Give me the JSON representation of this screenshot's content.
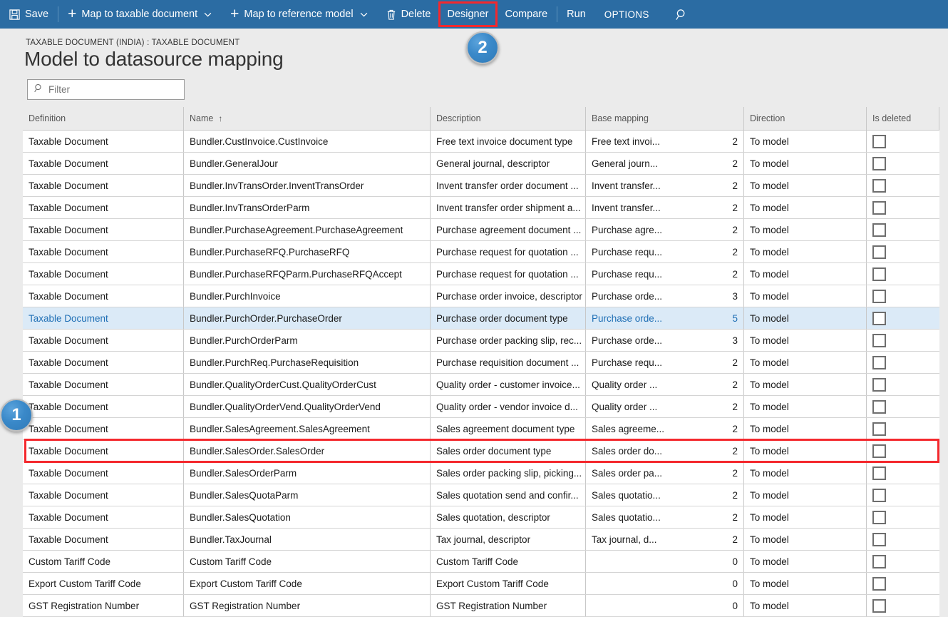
{
  "toolbar": {
    "save_label": "Save",
    "map_taxable_label": "Map to taxable document",
    "map_reference_label": "Map to reference model",
    "delete_label": "Delete",
    "designer_label": "Designer",
    "compare_label": "Compare",
    "run_label": "Run",
    "options_label": "OPTIONS",
    "chevron": "⌄",
    "plus": "+",
    "accent_color": "#2b6ca3",
    "highlight_color": "#f4282d"
  },
  "header": {
    "breadcrumb": "TAXABLE DOCUMENT (INDIA) : TAXABLE DOCUMENT",
    "title": "Model to datasource mapping"
  },
  "filter": {
    "placeholder": "Filter",
    "value": "Filter",
    "icon": "search-icon"
  },
  "grid": {
    "columns": [
      {
        "key": "definition",
        "label": "Definition"
      },
      {
        "key": "name",
        "label": "Name",
        "sorted": true,
        "sort_arrow": "↑"
      },
      {
        "key": "description",
        "label": "Description"
      },
      {
        "key": "base_mapping",
        "label": "Base mapping"
      },
      {
        "key": "direction",
        "label": "Direction"
      },
      {
        "key": "is_deleted",
        "label": "Is deleted"
      }
    ],
    "rows": [
      {
        "definition": "Taxable Document",
        "name": "Bundler.CustInvoice.CustInvoice",
        "description": "Free text invoice document type",
        "base_mapping": "Free text invoi...",
        "base_count": "2",
        "direction": "To model",
        "is_deleted": false,
        "selected": false
      },
      {
        "definition": "Taxable Document",
        "name": "Bundler.GeneralJour",
        "description": "General journal, descriptor",
        "base_mapping": "General journ...",
        "base_count": "2",
        "direction": "To model",
        "is_deleted": false,
        "selected": false
      },
      {
        "definition": "Taxable Document",
        "name": "Bundler.InvTransOrder.InventTransOrder",
        "description": "Invent transfer order document ...",
        "base_mapping": "Invent transfer...",
        "base_count": "2",
        "direction": "To model",
        "is_deleted": false,
        "selected": false
      },
      {
        "definition": "Taxable Document",
        "name": "Bundler.InvTransOrderParm",
        "description": "Invent transfer order shipment a...",
        "base_mapping": "Invent transfer...",
        "base_count": "2",
        "direction": "To model",
        "is_deleted": false,
        "selected": false
      },
      {
        "definition": "Taxable Document",
        "name": "Bundler.PurchaseAgreement.PurchaseAgreement",
        "description": "Purchase agreement document ...",
        "base_mapping": "Purchase agre...",
        "base_count": "2",
        "direction": "To model",
        "is_deleted": false,
        "selected": false
      },
      {
        "definition": "Taxable Document",
        "name": "Bundler.PurchaseRFQ.PurchaseRFQ",
        "description": "Purchase request for quotation ...",
        "base_mapping": "Purchase requ...",
        "base_count": "2",
        "direction": "To model",
        "is_deleted": false,
        "selected": false
      },
      {
        "definition": "Taxable Document",
        "name": "Bundler.PurchaseRFQParm.PurchaseRFQAccept",
        "description": "Purchase request for quotation ...",
        "base_mapping": "Purchase requ...",
        "base_count": "2",
        "direction": "To model",
        "is_deleted": false,
        "selected": false
      },
      {
        "definition": "Taxable Document",
        "name": "Bundler.PurchInvoice",
        "description": "Purchase order invoice, descriptor",
        "base_mapping": "Purchase orde...",
        "base_count": "3",
        "direction": "To model",
        "is_deleted": false,
        "selected": false
      },
      {
        "definition": "Taxable Document",
        "name": "Bundler.PurchOrder.PurchaseOrder",
        "description": "Purchase order document type",
        "base_mapping": "Purchase orde...",
        "base_count": "5",
        "direction": "To model",
        "is_deleted": false,
        "selected": true
      },
      {
        "definition": "Taxable Document",
        "name": "Bundler.PurchOrderParm",
        "description": "Purchase order packing slip, rec...",
        "base_mapping": "Purchase orde...",
        "base_count": "3",
        "direction": "To model",
        "is_deleted": false,
        "selected": false
      },
      {
        "definition": "Taxable Document",
        "name": "Bundler.PurchReq.PurchaseRequisition",
        "description": "Purchase requisition document ...",
        "base_mapping": "Purchase requ...",
        "base_count": "2",
        "direction": "To model",
        "is_deleted": false,
        "selected": false
      },
      {
        "definition": "Taxable Document",
        "name": "Bundler.QualityOrderCust.QualityOrderCust",
        "description": "Quality order - customer invoice...",
        "base_mapping": "Quality order ...",
        "base_count": "2",
        "direction": "To model",
        "is_deleted": false,
        "selected": false
      },
      {
        "definition": "Taxable Document",
        "name": "Bundler.QualityOrderVend.QualityOrderVend",
        "description": "Quality order - vendor invoice d...",
        "base_mapping": "Quality order ...",
        "base_count": "2",
        "direction": "To model",
        "is_deleted": false,
        "selected": false
      },
      {
        "definition": "Taxable Document",
        "name": "Bundler.SalesAgreement.SalesAgreement",
        "description": "Sales agreement document type",
        "base_mapping": "Sales agreeme...",
        "base_count": "2",
        "direction": "To model",
        "is_deleted": false,
        "selected": false
      },
      {
        "definition": "Taxable Document",
        "name": "Bundler.SalesOrder.SalesOrder",
        "description": "Sales order document type",
        "base_mapping": "Sales order do...",
        "base_count": "2",
        "direction": "To model",
        "is_deleted": false,
        "selected": false,
        "highlighted": true
      },
      {
        "definition": "Taxable Document",
        "name": "Bundler.SalesOrderParm",
        "description": "Sales order packing slip, picking...",
        "base_mapping": "Sales order pa...",
        "base_count": "2",
        "direction": "To model",
        "is_deleted": false,
        "selected": false
      },
      {
        "definition": "Taxable Document",
        "name": "Bundler.SalesQuotaParm",
        "description": "Sales quotation send and confir...",
        "base_mapping": "Sales quotatio...",
        "base_count": "2",
        "direction": "To model",
        "is_deleted": false,
        "selected": false
      },
      {
        "definition": "Taxable Document",
        "name": "Bundler.SalesQuotation",
        "description": "Sales quotation, descriptor",
        "base_mapping": "Sales quotatio...",
        "base_count": "2",
        "direction": "To model",
        "is_deleted": false,
        "selected": false
      },
      {
        "definition": "Taxable Document",
        "name": "Bundler.TaxJournal",
        "description": "Tax journal, descriptor",
        "base_mapping": "Tax journal, d...",
        "base_count": "2",
        "direction": "To model",
        "is_deleted": false,
        "selected": false
      },
      {
        "definition": "Custom Tariff Code",
        "name": "Custom Tariff Code",
        "description": "Custom Tariff Code",
        "base_mapping": "",
        "base_count": "0",
        "direction": "To model",
        "is_deleted": false,
        "selected": false
      },
      {
        "definition": "Export Custom Tariff Code",
        "name": "Export Custom Tariff Code",
        "description": "Export Custom Tariff Code",
        "base_mapping": "",
        "base_count": "0",
        "direction": "To model",
        "is_deleted": false,
        "selected": false
      },
      {
        "definition": "GST Registration Number",
        "name": "GST Registration Number",
        "description": "GST Registration Number",
        "base_mapping": "",
        "base_count": "0",
        "direction": "To model",
        "is_deleted": false,
        "selected": false
      }
    ]
  },
  "annotations": {
    "badge_one": "1",
    "badge_two": "2"
  }
}
